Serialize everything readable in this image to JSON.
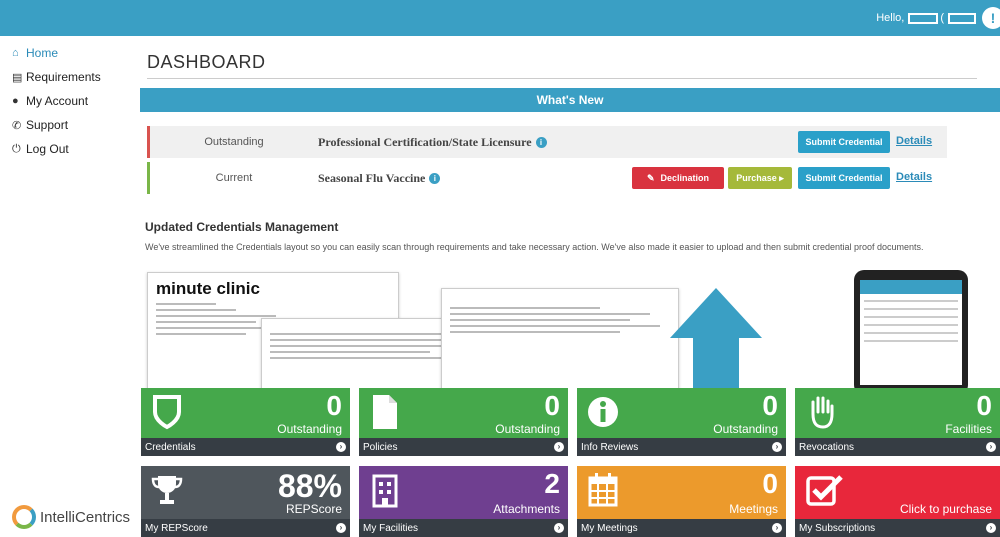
{
  "header": {
    "greeting": "Hello,"
  },
  "sidebar": {
    "items": [
      {
        "label": "Home",
        "icon": "home-icon"
      },
      {
        "label": "Requirements",
        "icon": "list-icon"
      },
      {
        "label": "My Account",
        "icon": "user-icon"
      },
      {
        "label": "Support",
        "icon": "phone-icon"
      },
      {
        "label": "Log Out",
        "icon": "power-icon"
      }
    ],
    "logo": "IntelliCentrics"
  },
  "main": {
    "title": "DASHBOARD",
    "whats_new": "What's New",
    "credentials": [
      {
        "status": "Outstanding",
        "name": "Professional Certification/State Licensure",
        "submit": "Submit Credential",
        "details": "Details"
      },
      {
        "status": "Current",
        "name": "Seasonal Flu Vaccine",
        "declination": "Declination",
        "purchase": "Purchase ▸",
        "submit": "Submit Credential",
        "details": "Details"
      }
    ],
    "updated_title": "Updated Credentials Management",
    "updated_text": "We've streamlined the Credentials layout so you can easily scan through requirements and take necessary action. We've also made it easier to upload and then submit credential proof documents.",
    "preview": {
      "brand": "minute clinic"
    }
  },
  "tiles_row1": [
    {
      "value": "0",
      "sub": "Outstanding",
      "label": "Credentials",
      "icon": "shield-icon",
      "color": "#45a84b"
    },
    {
      "value": "0",
      "sub": "Outstanding",
      "label": "Policies",
      "icon": "document-icon",
      "color": "#45a84b"
    },
    {
      "value": "0",
      "sub": "Outstanding",
      "label": "Info Reviews",
      "icon": "info-icon",
      "color": "#45a84b"
    },
    {
      "value": "0",
      "sub": "Facilities",
      "label": "Revocations",
      "icon": "hand-icon",
      "color": "#45a84b"
    }
  ],
  "tiles_row2": [
    {
      "value": "88%",
      "sub": "REPScore",
      "label": "My REPScore",
      "icon": "trophy-icon",
      "color": "#4f565c"
    },
    {
      "value": "2",
      "sub": "Attachments",
      "label": "My Facilities",
      "icon": "building-icon",
      "color": "#6f3f90"
    },
    {
      "value": "0",
      "sub": "Meetings",
      "label": "My Meetings",
      "icon": "calendar-icon",
      "color": "#ec9a2c"
    },
    {
      "value": "",
      "sub": "Click to purchase",
      "label": "My Subscriptions",
      "icon": "checkbox-icon",
      "color": "#e8273b"
    }
  ]
}
